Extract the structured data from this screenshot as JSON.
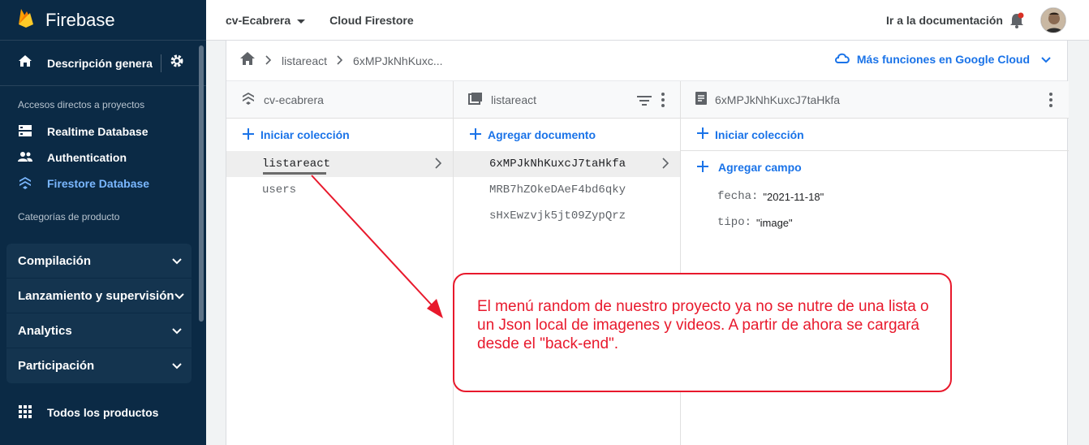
{
  "sidebar": {
    "brand": "Firebase",
    "overview_label": "Descripción genera...",
    "shortcuts_title": "Accesos directos a proyectos",
    "shortcuts": [
      {
        "label": "Realtime Database",
        "icon": "database-icon"
      },
      {
        "label": "Authentication",
        "icon": "people-icon"
      },
      {
        "label": "Firestore Database",
        "icon": "firestore-icon"
      }
    ],
    "categories_title": "Categorías de producto",
    "categories": [
      "Compilación",
      "Lanzamiento y supervisión",
      "Analytics",
      "Participación"
    ],
    "all_products": "Todos los productos"
  },
  "header": {
    "project": "cv-Ecabrera",
    "product": "Cloud Firestore",
    "docs_link": "Ir a la documentación"
  },
  "breadcrumb": {
    "items": [
      "listareact",
      "6xMPJkNhKuxc..."
    ],
    "gcloud_link": "Más funciones en Google Cloud"
  },
  "columns": {
    "root": {
      "title": "cv-ecabrera",
      "action": "Iniciar colección",
      "items": [
        "listareact",
        "users"
      ]
    },
    "collection": {
      "title": "listareact",
      "action": "Agregar documento",
      "items": [
        "6xMPJkNhKuxcJ7taHkfa",
        "MRB7hZOkeDAeF4bd6qky",
        "sHxEwzvjk5jt09ZypQrz"
      ]
    },
    "document": {
      "title": "6xMPJkNhKuxcJ7taHkfa",
      "action": "Iniciar colección",
      "add_field": "Agregar campo",
      "fields": [
        {
          "key": "fecha:",
          "value": "\"2021-11-18\""
        },
        {
          "key": "tipo:",
          "value": "\"image\""
        }
      ]
    }
  },
  "annotation": {
    "text": "El menú random de nuestro proyecto ya no se nutre de una lista o un Json local de imagenes y videos. A partir de ahora se cargará desde el \"back-end\"."
  },
  "colors": {
    "sidebar_bg": "#0b2a45",
    "accent": "#1a73e8",
    "annotation_red": "#e8192c"
  }
}
